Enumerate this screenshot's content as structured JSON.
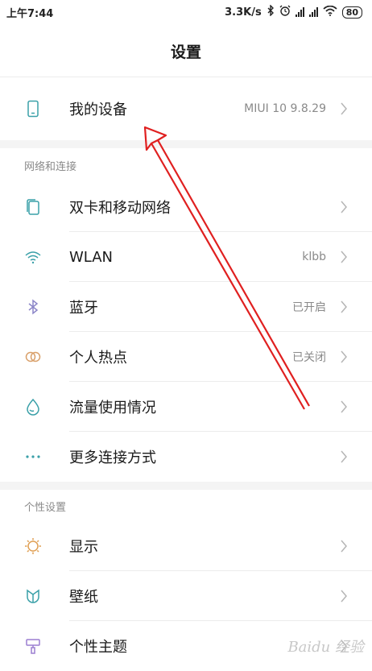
{
  "status_bar": {
    "time": "上午7:44",
    "speed": "3.3K/s",
    "battery": "80"
  },
  "page": {
    "title": "设置"
  },
  "my_device": {
    "label": "我的设备",
    "value": "MIUI 10 9.8.29"
  },
  "sections": [
    {
      "header": "网络和连接",
      "items": [
        {
          "label": "双卡和移动网络",
          "value": "",
          "icon": "sim-icon"
        },
        {
          "label": "WLAN",
          "value": "klbb",
          "icon": "wifi-icon"
        },
        {
          "label": "蓝牙",
          "value": "已开启",
          "icon": "bluetooth-icon"
        },
        {
          "label": "个人热点",
          "value": "已关闭",
          "icon": "hotspot-icon"
        },
        {
          "label": "流量使用情况",
          "value": "",
          "icon": "data-usage-icon"
        },
        {
          "label": "更多连接方式",
          "value": "",
          "icon": "more-icon"
        }
      ]
    },
    {
      "header": "个性设置",
      "items": [
        {
          "label": "显示",
          "value": "",
          "icon": "display-icon"
        },
        {
          "label": "壁纸",
          "value": "",
          "icon": "wallpaper-icon"
        },
        {
          "label": "个性主题",
          "value": "",
          "icon": "theme-icon"
        }
      ]
    }
  ],
  "watermark": "Baidu 经验",
  "colors": {
    "accent_teal": "#3aa0a8",
    "bluetooth": "#8c86c8",
    "hotspot": "#d9a06a",
    "display": "#e0a055",
    "theme": "#9b7fd1",
    "annotation_arrow": "#e02020"
  }
}
